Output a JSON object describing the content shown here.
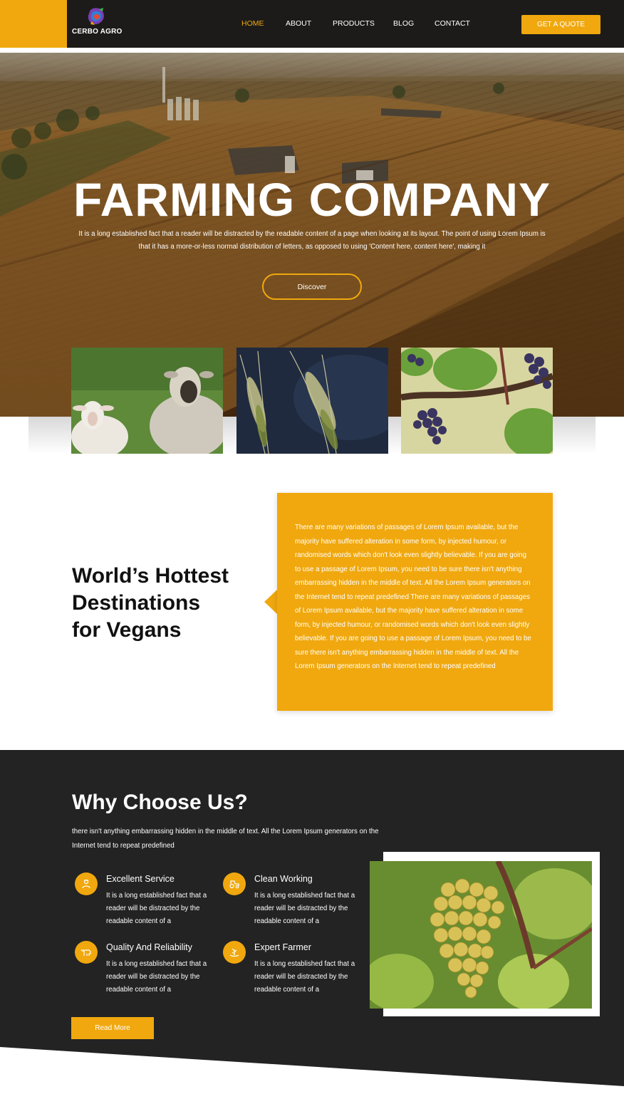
{
  "brand": {
    "name": "CERBO AGRO"
  },
  "nav": {
    "items": [
      "HOME",
      "ABOUT",
      "PRODUCTS",
      "BLOG",
      "CONTACT"
    ],
    "active": "HOME",
    "cta": "GET A QUOTE"
  },
  "hero": {
    "title": "FARMING COMPANY",
    "text": "It is a long established fact that a reader will be distracted by the readable content of a page when looking at its layout. The point of using Lorem Ipsum is that it has a more-or-less normal distribution of letters, as opposed to using 'Content here, content here', making it",
    "button": "Discover"
  },
  "about": {
    "heading_lines": [
      "World’s Hottest",
      "Destinations",
      "for Vegans"
    ],
    "text": "There are many variations of passages of Lorem Ipsum available, but the majority have suffered alteration in some form, by injected humour, or randomised words which don't look even slightly believable. If you are going to use a passage of Lorem Ipsum, you need to be sure there isn't anything embarrassing hidden in the middle of text. All the Lorem Ipsum generators on the Internet tend to repeat predefined There are many variations of passages of Lorem Ipsum available, but the majority have suffered alteration in some form, by injected humour, or randomised words which don't look even slightly believable. If you are going to use a passage of Lorem Ipsum, you need to be sure there isn't anything embarrassing hidden in the middle of text. All the Lorem Ipsum generators on the Internet tend to repeat predefined"
  },
  "why": {
    "title": "Why Choose Us?",
    "subtitle": "there isn't anything embarrassing hidden in the middle of text. All the Lorem Ipsum generators on the Internet tend to repeat predefined",
    "features": [
      {
        "title": "Excellent Service",
        "text": "It is a long established fact that a reader will be distracted by the readable content of a",
        "icon": "farmer-icon"
      },
      {
        "title": "Clean Working",
        "text": "It is a long established fact that a reader will be distracted by the readable content of a",
        "icon": "tractor-icon"
      },
      {
        "title": "Quality And Reliability",
        "text": "It is a long established fact that a reader will be distracted by the readable content of a",
        "icon": "cow-icon"
      },
      {
        "title": "Expert Farmer",
        "text": "It is a long established fact that a reader will be distracted by the readable content of a",
        "icon": "harvest-icon"
      }
    ],
    "button": "Read More"
  },
  "colors": {
    "accent": "#f0a80e",
    "dark": "#232323",
    "header": "#1c1b19"
  }
}
